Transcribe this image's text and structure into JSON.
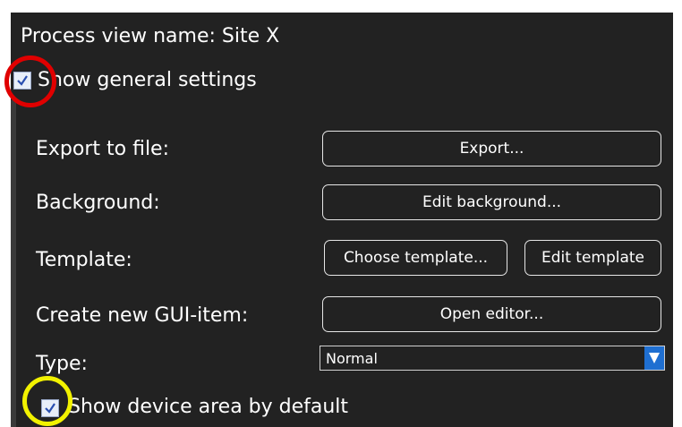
{
  "panel": {
    "process_view_name": "Process view name: Site X",
    "show_general_settings": {
      "label": "Show general settings",
      "checked": true
    },
    "rows": {
      "export_label": "Export to file:",
      "export_button": "Export...",
      "background_label": "Background:",
      "background_button": "Edit background...",
      "template_label": "Template:",
      "choose_template_button": "Choose template...",
      "edit_template_button": "Edit template",
      "create_gui_label": "Create new GUI-item:",
      "open_editor_button": "Open editor...",
      "type_label": "Type:",
      "type_value": "Normal"
    },
    "show_device_area": {
      "label": "Show device area by default",
      "checked": true
    }
  },
  "annotations": {
    "ring_general_color": "#e00000",
    "ring_device_color": "#f2f200"
  },
  "colors": {
    "panel_bg": "#222222",
    "dropdown_arrow": "#1f6fd1"
  }
}
